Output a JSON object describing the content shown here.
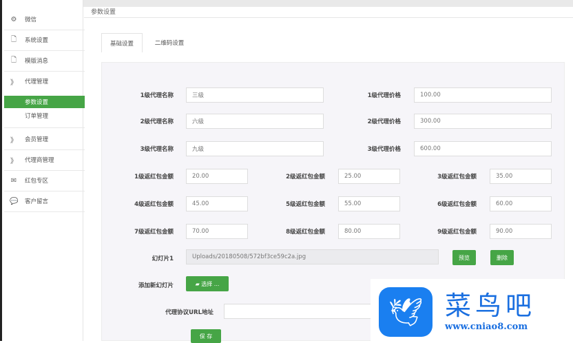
{
  "header": {
    "title": "参数设置"
  },
  "sidebar": {
    "items": [
      {
        "label": "微信",
        "icon": "share-icon"
      },
      {
        "label": "系统设置",
        "icon": "file-icon"
      },
      {
        "label": "模版消息",
        "icon": "file-icon"
      },
      {
        "label": "代理管理",
        "icon": "rss-icon"
      },
      {
        "label": "会员管理",
        "icon": "rss-icon"
      },
      {
        "label": "代理商管理",
        "icon": "rss-icon"
      },
      {
        "label": "红包专区",
        "icon": "mail-icon"
      },
      {
        "label": "客户留言",
        "icon": "chat-icon"
      }
    ],
    "sub": [
      {
        "label": "参数设置",
        "active": true
      },
      {
        "label": "订单管理"
      }
    ]
  },
  "tabs": [
    {
      "label": "基础设置",
      "active": true
    },
    {
      "label": "二维码设置"
    }
  ],
  "form": {
    "agent_names": [
      {
        "label": "1级代理名称",
        "value": "三级"
      },
      {
        "label": "2级代理名称",
        "value": "六级"
      },
      {
        "label": "3级代理名称",
        "value": "九级"
      }
    ],
    "agent_prices": [
      {
        "label": "1级代理价格",
        "value": "100.00"
      },
      {
        "label": "2级代理价格",
        "value": "300.00"
      },
      {
        "label": "3级代理价格",
        "value": "600.00"
      }
    ],
    "redpacks": [
      {
        "label": "1级返红包金额",
        "value": "20.00"
      },
      {
        "label": "2级返红包金额",
        "value": "25.00"
      },
      {
        "label": "3级返红包金额",
        "value": "35.00"
      },
      {
        "label": "4级返红包金额",
        "value": "45.00"
      },
      {
        "label": "5级返红包金额",
        "value": "55.00"
      },
      {
        "label": "6级返红包金额",
        "value": "60.00"
      },
      {
        "label": "7级返红包金额",
        "value": "70.00"
      },
      {
        "label": "8级返红包金额",
        "value": "80.00"
      },
      {
        "label": "9级返红包金额",
        "value": "90.00"
      }
    ],
    "slide_label": "幻灯片1",
    "slide_value": "Uploads/20180508/572bf3ce59c2a.jpg",
    "preview": "预览",
    "delete": "删除",
    "add_slide_label": "添加新幻灯片",
    "choose": "选择 ...",
    "url_label": "代理协议URL地址",
    "url_value": "",
    "save": "保 存"
  },
  "watermark": {
    "name": "菜鸟吧",
    "url": "www.cniao8.com"
  },
  "colors": {
    "accent": "#46a546",
    "watermark": "#1a7ff0"
  }
}
